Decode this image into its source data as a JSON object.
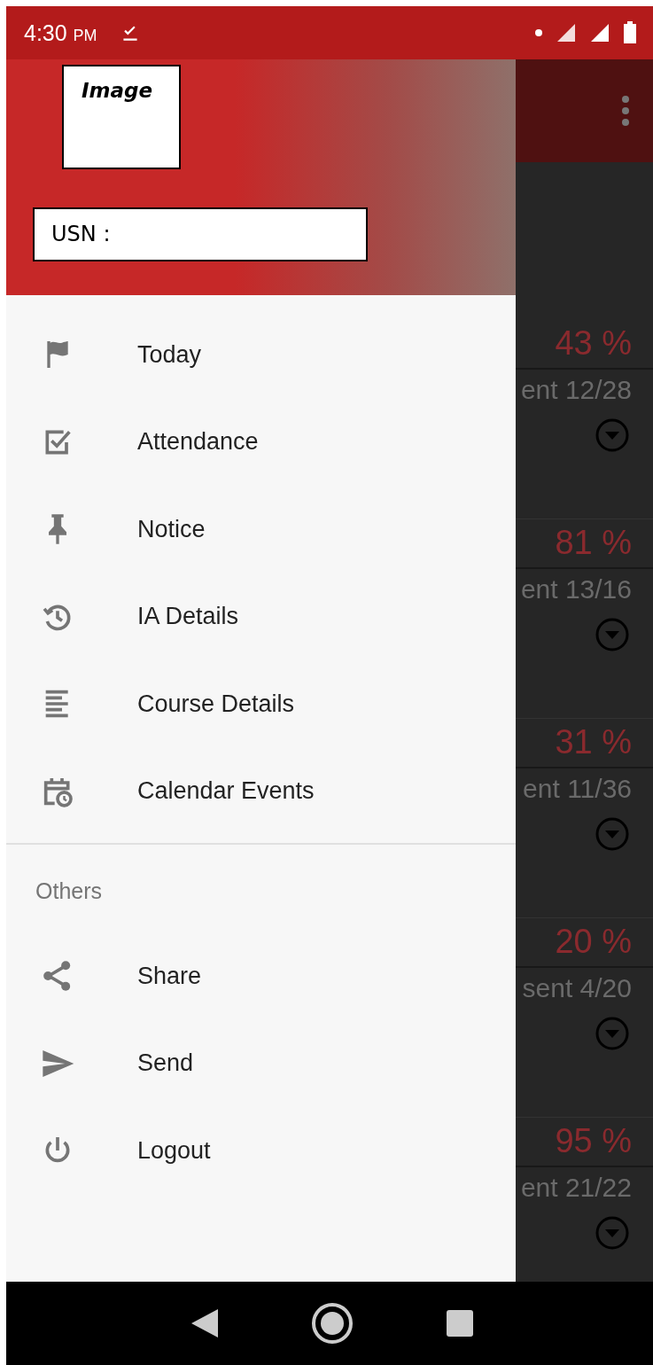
{
  "status_bar": {
    "time": "4:30",
    "time_suffix": "PM"
  },
  "drawer": {
    "header": {
      "image_label": "Image",
      "usn_label": "USN :"
    },
    "items": [
      {
        "kind": "flag",
        "label": "Today"
      },
      {
        "kind": "check",
        "label": "Attendance"
      },
      {
        "kind": "pin",
        "label": "Notice"
      },
      {
        "kind": "history",
        "label": "IA Details"
      },
      {
        "kind": "lines",
        "label": "Course Details"
      },
      {
        "kind": "calendar",
        "label": "Calendar Events"
      }
    ],
    "section": {
      "title": "Others",
      "items": [
        {
          "kind": "share",
          "label": "Share"
        },
        {
          "kind": "send",
          "label": "Send"
        },
        {
          "kind": "power",
          "label": "Logout"
        }
      ]
    }
  },
  "background": {
    "cards": [
      {
        "percent": "43 %",
        "attendance": "ent 12/28"
      },
      {
        "percent": "81 %",
        "attendance": "ent 13/16"
      },
      {
        "percent": "31 %",
        "attendance": "ent 11/36"
      },
      {
        "percent": "20 %",
        "attendance": "sent 4/20"
      },
      {
        "percent": "95 %",
        "attendance": "ent 21/22"
      }
    ]
  }
}
